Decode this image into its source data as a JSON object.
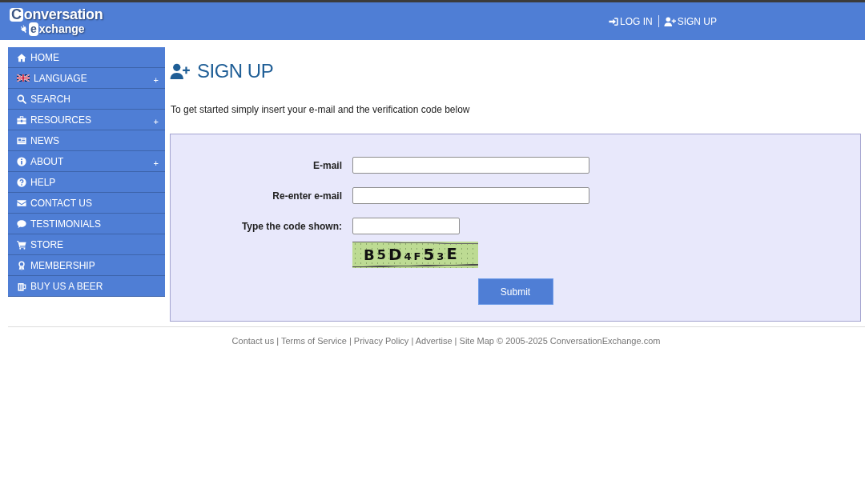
{
  "header": {
    "logo": {
      "line_1": "Conversation",
      "line_2": "exchange"
    },
    "nav": [
      "LOG IN",
      "SIGN UP"
    ]
  },
  "sidebar": {
    "items": [
      {
        "label": "HOME"
      },
      {
        "label": "LANGUAGE",
        "toggle": "+"
      },
      {
        "label": "SEARCH"
      },
      {
        "label": "RESOURCES",
        "toggle": "+"
      },
      {
        "label": "NEWS"
      },
      {
        "label": "ABOUT",
        "toggle": "+"
      },
      {
        "label": "HELP"
      },
      {
        "label": "CONTACT US"
      },
      {
        "label": "TESTIMONIALS"
      },
      {
        "label": "STORE"
      },
      {
        "label": "MEMBERSHIP"
      },
      {
        "label": "BUY US A BEER"
      }
    ]
  },
  "main": {
    "title": "SIGN UP",
    "intro": "To get started simply insert your e-mail and the verification code below",
    "form": {
      "fields": [
        {
          "label": "E-mail",
          "kind": "email"
        },
        {
          "label": "Re-enter e-mail",
          "kind": "email"
        },
        {
          "label": "Type the code shown:",
          "kind": "code"
        }
      ],
      "captcha": {
        "code": "B5D4F53E"
      },
      "submit": "Submit"
    }
  },
  "footer": {
    "links": [
      "Contact us",
      "Terms of Service",
      "Privacy Policy",
      "Advertise",
      "Site Map"
    ],
    "separator": "|",
    "copyright": "© 2005-2025 ConversationExchange.com"
  }
}
